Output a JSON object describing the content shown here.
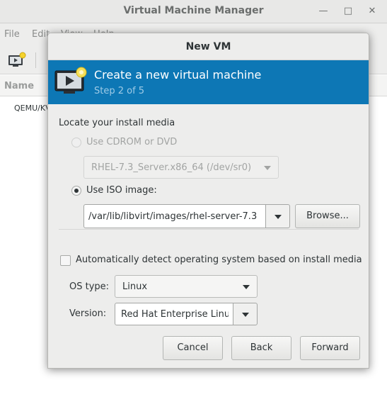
{
  "main_window": {
    "title": "Virtual Machine Manager",
    "menu": [
      "File",
      "Edit",
      "View",
      "Help"
    ],
    "list_header": "Name",
    "list_row": "QEMU/KVM"
  },
  "dialog": {
    "title": "New VM",
    "banner": {
      "title": "Create a new virtual machine",
      "step": "Step 2 of 5"
    },
    "section_label": "Locate your install media",
    "cdrom_option": "Use CDROM or DVD",
    "cdrom_device": "RHEL-7.3_Server.x86_64 (/dev/sr0)",
    "iso_option": "Use ISO image:",
    "iso_path": "/var/lib/libvirt/images/rhel-server-7.3",
    "browse_label": "Browse...",
    "autodetect_label": "Automatically detect operating system based on install media",
    "os_type_label": "OS type:",
    "os_type_value": "Linux",
    "version_label": "Version:",
    "version_value": "Red Hat Enterprise Linux",
    "buttons": {
      "cancel": "Cancel",
      "back": "Back",
      "forward": "Forward"
    },
    "accent_color": "#0d77b5"
  }
}
